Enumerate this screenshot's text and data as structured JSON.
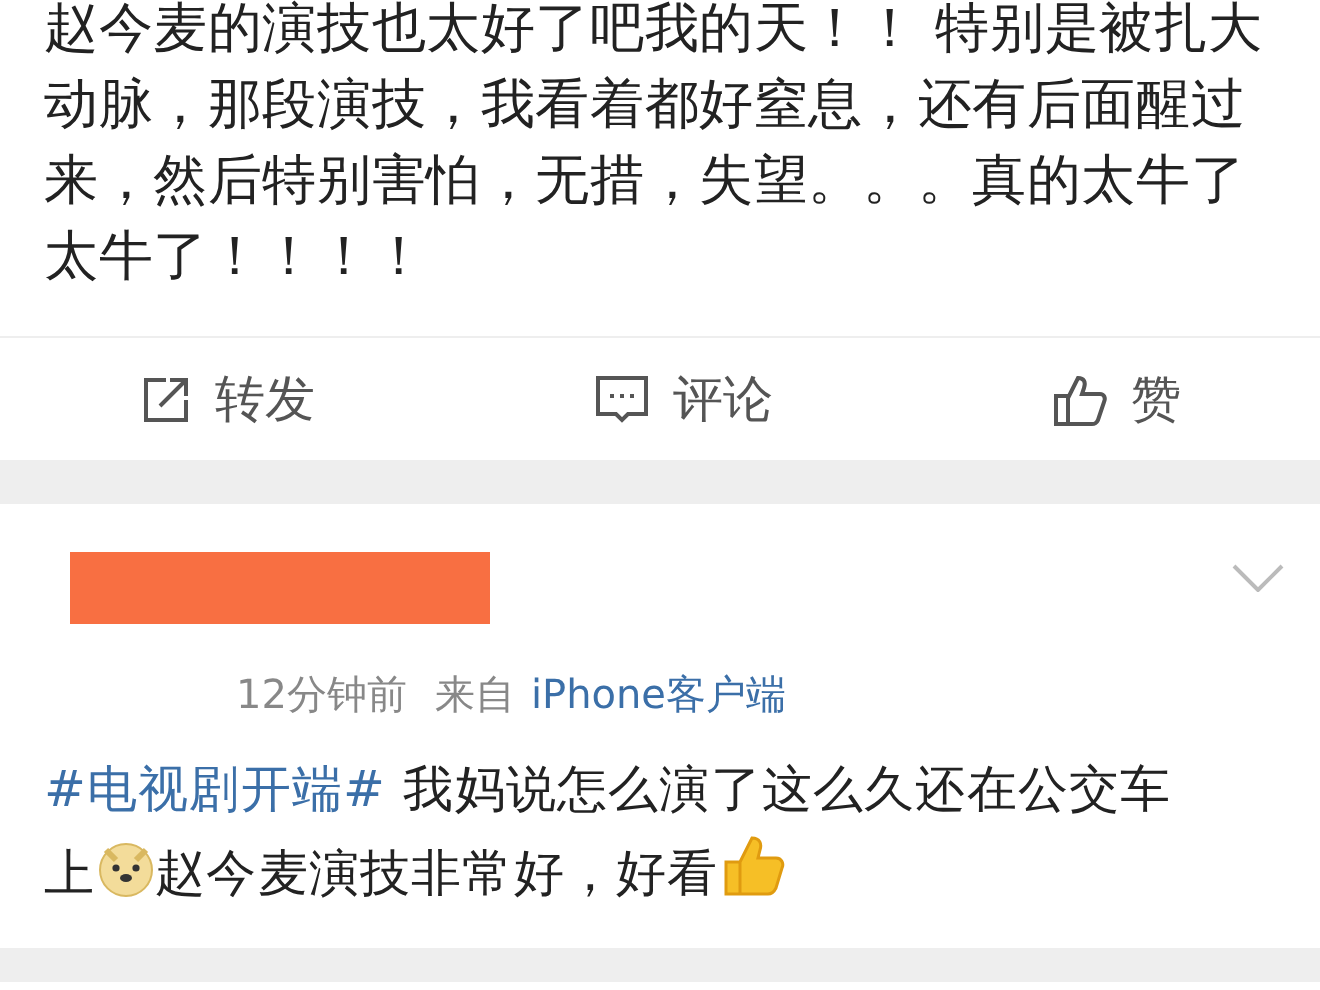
{
  "post": {
    "text": "赵今麦的演技也太好了吧我的天！！ 特别是被扎大动脉，那段演技，我看着都好窒息，还有后面醒过来，然后特别害怕，无措，失望。。。真的太牛了太牛了！！！！"
  },
  "actions": [
    {
      "kind": "repost",
      "label": "转发"
    },
    {
      "kind": "comment",
      "label": "评论"
    },
    {
      "kind": "like",
      "label": "赞"
    }
  ],
  "comment": {
    "time": "12分钟前",
    "source_prefix": "来自",
    "source": "iPhone客户端",
    "parts": [
      {
        "kind": "hashtag",
        "text": "#电视剧开端#"
      },
      {
        "kind": "text",
        "text": " 我妈说怎么演了这么久还在公交车上"
      },
      {
        "kind": "doge"
      },
      {
        "kind": "text",
        "text": "赵今麦演技非常好，好看"
      },
      {
        "kind": "thumb"
      }
    ]
  }
}
